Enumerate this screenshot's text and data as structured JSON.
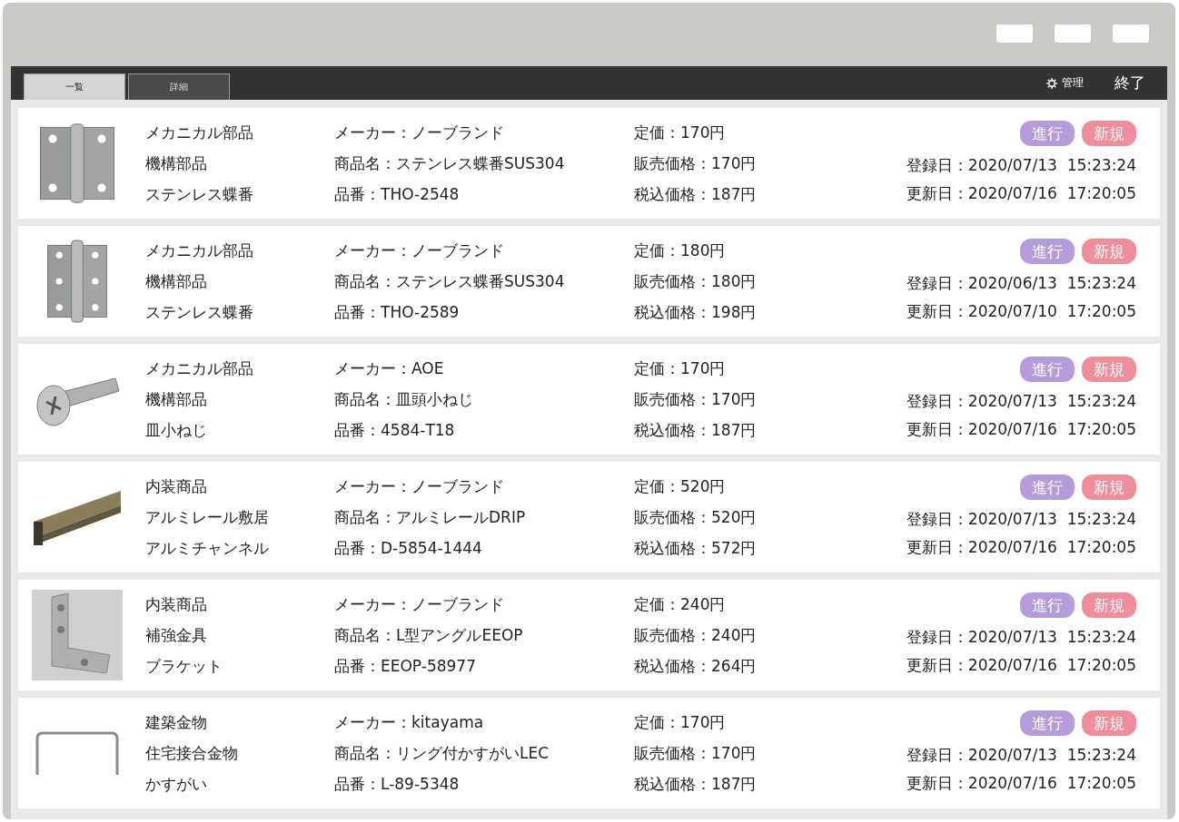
{
  "window_controls": [
    {
      "kind": "button"
    },
    {
      "kind": "button"
    },
    {
      "kind": "button"
    }
  ],
  "tabs": [
    {
      "label": "一覧",
      "selected": true
    },
    {
      "label": "詳細",
      "selected": false
    }
  ],
  "toolbar": {
    "settings_label": "管理",
    "exit_label": "終了"
  },
  "rows": [
    {
      "image": {
        "kind": "hinge"
      },
      "category": [
        "メカニカル部品",
        "機構部品",
        "ステンレス蝶番"
      ],
      "info": [
        "メーカー：ノーブランド",
        "商品名：ステンレス蝶番SUS304",
        "品番：THO-2548"
      ],
      "prices": [
        "定価：170円",
        "販売価格：170円",
        "税込価格：187円"
      ],
      "badges": [
        {
          "label": "進行",
          "color": "#b59cd9"
        },
        {
          "label": "新規",
          "color": "#ef8d9b"
        }
      ],
      "dates": [
        "登録日：2020/07/13  15:23:24",
        "更新日：2020/07/16  17:20:05"
      ]
    },
    {
      "image": {
        "kind": "hinge-narrow"
      },
      "category": [
        "メカニカル部品",
        "機構部品",
        "ステンレス蝶番"
      ],
      "info": [
        "メーカー：ノーブランド",
        "商品名：ステンレス蝶番SUS304",
        "品番：THO-2589"
      ],
      "prices": [
        "定価：180円",
        "販売価格：180円",
        "税込価格：198円"
      ],
      "badges": [
        {
          "label": "進行",
          "color": "#b59cd9"
        },
        {
          "label": "新規",
          "color": "#ef8d9b"
        }
      ],
      "dates": [
        "登録日：2020/06/13  15:23:24",
        "更新日：2020/07/10  17:20:05"
      ]
    },
    {
      "image": {
        "kind": "screw"
      },
      "category": [
        "メカニカル部品",
        "機構部品",
        "皿小ねじ"
      ],
      "info": [
        "メーカー：AOE",
        "商品名：皿頭小ねじ",
        "品番：4584-T18"
      ],
      "prices": [
        "定価：170円",
        "販売価格：170円",
        "税込価格：187円"
      ],
      "badges": [
        {
          "label": "進行",
          "color": "#b59cd9"
        },
        {
          "label": "新規",
          "color": "#ef8d9b"
        }
      ],
      "dates": [
        "登録日：2020/07/13  15:23:24",
        "更新日：2020/07/16  17:20:05"
      ]
    },
    {
      "image": {
        "kind": "channel"
      },
      "category": [
        "内装商品",
        "アルミレール敷居",
        "アルミチャンネル"
      ],
      "info": [
        "メーカー：ノーブランド",
        "商品名：アルミレールDRIP",
        "品番：D-5854-1444"
      ],
      "prices": [
        "定価：520円",
        "販売価格：520円",
        "税込価格：572円"
      ],
      "badges": [
        {
          "label": "進行",
          "color": "#b59cd9"
        },
        {
          "label": "新規",
          "color": "#ef8d9b"
        }
      ],
      "dates": [
        "登録日：2020/07/13  15:23:24",
        "更新日：2020/07/16  17:20:05"
      ]
    },
    {
      "image": {
        "kind": "bracket"
      },
      "category": [
        "内装商品",
        "補強金具",
        "ブラケット"
      ],
      "info": [
        "メーカー：ノーブランド",
        "商品名：L型アングルEEOP",
        "品番：EEOP-58977"
      ],
      "prices": [
        "定価：240円",
        "販売価格：240円",
        "税込価格：264円"
      ],
      "badges": [
        {
          "label": "進行",
          "color": "#b59cd9"
        },
        {
          "label": "新規",
          "color": "#ef8d9b"
        }
      ],
      "dates": [
        "登録日：2020/07/13  15:23:24",
        "更新日：2020/07/16  17:20:05"
      ]
    },
    {
      "image": {
        "kind": "staple"
      },
      "category": [
        "建築金物",
        "住宅接合金物",
        "かすがい"
      ],
      "info": [
        "メーカー：kitayama",
        "商品名：リング付かすがいLEC",
        "品番：L-89-5348"
      ],
      "prices": [
        "定価：170円",
        "販売価格：170円",
        "税込価格：187円"
      ],
      "badges": [
        {
          "label": "進行",
          "color": "#b59cd9"
        },
        {
          "label": "新規",
          "color": "#ef8d9b"
        }
      ],
      "dates": [
        "登録日：2020/07/13  15:23:24",
        "更新日：2020/07/16  17:20:05"
      ]
    }
  ]
}
